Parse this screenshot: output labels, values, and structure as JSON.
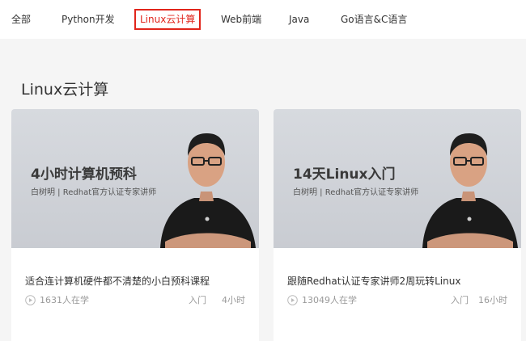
{
  "tabs": [
    {
      "label": "全部",
      "active": false
    },
    {
      "label": "Python开发",
      "active": false
    },
    {
      "label": "Linux云计算",
      "active": true
    },
    {
      "label": "Web前端",
      "active": false
    },
    {
      "label": "Java",
      "active": false
    },
    {
      "label": "Go语言&C语言",
      "active": false
    }
  ],
  "section": {
    "title": "Linux云计算"
  },
  "courses": [
    {
      "banner_title": "4小时计算机预科",
      "banner_subtitle": "白树明 | Redhat官方认证专家讲师",
      "title": "适合连计算机硬件都不清楚的小白预科课程",
      "learners": "1631人在学",
      "level": "入门",
      "duration": "4小时"
    },
    {
      "banner_title": "14天Linux入门",
      "banner_subtitle": "白树明 | Redhat官方认证专家讲师",
      "title": "跟随Redhat认证专家讲师2周玩转Linux",
      "learners": "13049人在学",
      "level": "入门",
      "duration": "16小时"
    }
  ],
  "colors": {
    "accent": "#e1251b",
    "background": "#f5f5f5",
    "banner": "#d2d5da"
  },
  "icons": {
    "play": "play-circle-icon",
    "instructor": "instructor-portrait"
  }
}
